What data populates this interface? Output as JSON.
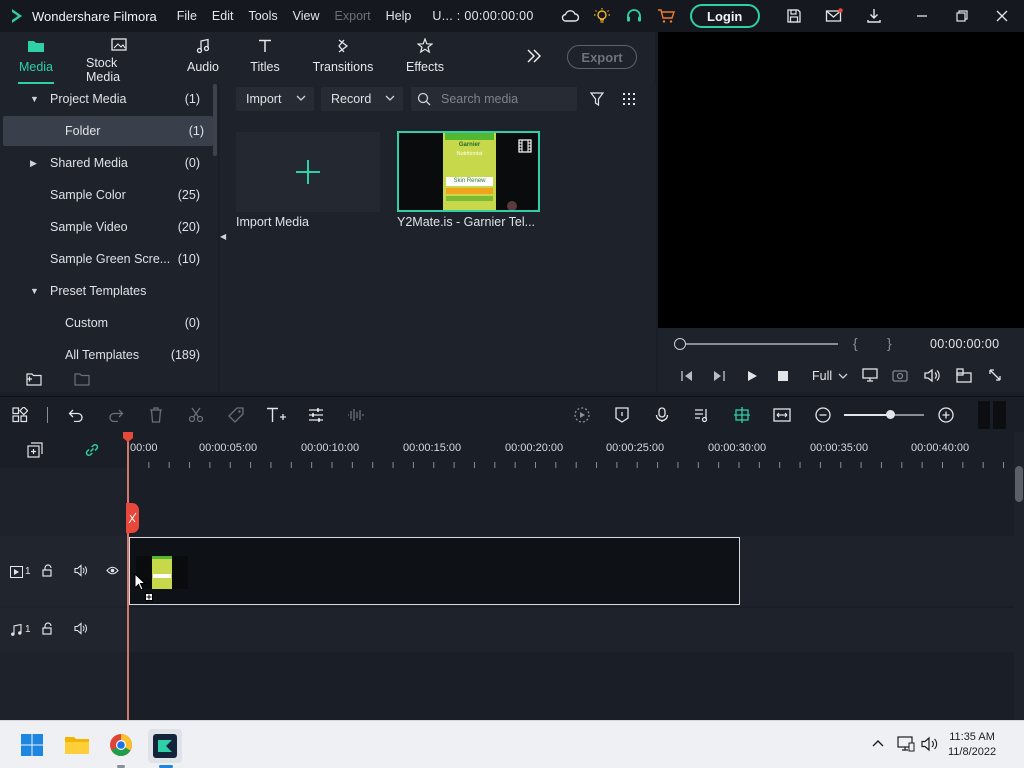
{
  "app": {
    "name": "Wondershare Filmora",
    "project_name": "U... : 00:00:00:00",
    "login_label": "Login",
    "accent": "#2fcfa8"
  },
  "menu": [
    "File",
    "Edit",
    "Tools",
    "View",
    "Export",
    "Help"
  ],
  "menu_disabled": [
    "Export"
  ],
  "media_tabs": [
    {
      "label": "Media",
      "icon": "folder-icon",
      "active": true
    },
    {
      "label": "Stock Media",
      "icon": "stock-media-icon"
    },
    {
      "label": "Audio",
      "icon": "music-note-icon"
    },
    {
      "label": "Titles",
      "icon": "text-t-icon"
    },
    {
      "label": "Transitions",
      "icon": "transition-icon"
    },
    {
      "label": "Effects",
      "icon": "effects-icon"
    }
  ],
  "export_button": "Export",
  "sidebar": {
    "items": [
      {
        "label": "Project Media",
        "count": "(1)",
        "arrow": "▼"
      },
      {
        "label": "Folder",
        "count": "(1)",
        "selected": true
      },
      {
        "label": "Shared Media",
        "count": "(0)",
        "arrow": "▶"
      },
      {
        "label": "Sample Color",
        "count": "(25)"
      },
      {
        "label": "Sample Video",
        "count": "(20)"
      },
      {
        "label": "Sample Green Scre...",
        "count": "(10)"
      },
      {
        "label": "Preset Templates",
        "count": "",
        "arrow": "▼"
      },
      {
        "label": "Custom",
        "count": "(0)",
        "indent": true
      },
      {
        "label": "All Templates",
        "count": "(189)",
        "indent": true
      }
    ]
  },
  "media_toolbar": {
    "import_label": "Import",
    "record_label": "Record",
    "search_placeholder": "Search media"
  },
  "media_items": [
    {
      "label": "Import Media"
    },
    {
      "label": "Y2Mate.is - Garnier  Tel..."
    }
  ],
  "thumbnail_text": [
    "Garnier",
    "Nutritionist",
    "Skin Renew"
  ],
  "preview": {
    "timecode": "00:00:00:00",
    "quality": "Full",
    "bracket_in": "{",
    "bracket_out": "}"
  },
  "ruler_ticks": [
    "00:00",
    "00:00:05:00",
    "00:00:10:00",
    "00:00:15:00",
    "00:00:20:00",
    "00:00:25:00",
    "00:00:30:00",
    "00:00:35:00",
    "00:00:40:00"
  ],
  "tracks": {
    "video_label": "1",
    "audio_label": "1"
  },
  "taskbar": {
    "time": "11:35 AM",
    "date": "11/8/2022"
  }
}
